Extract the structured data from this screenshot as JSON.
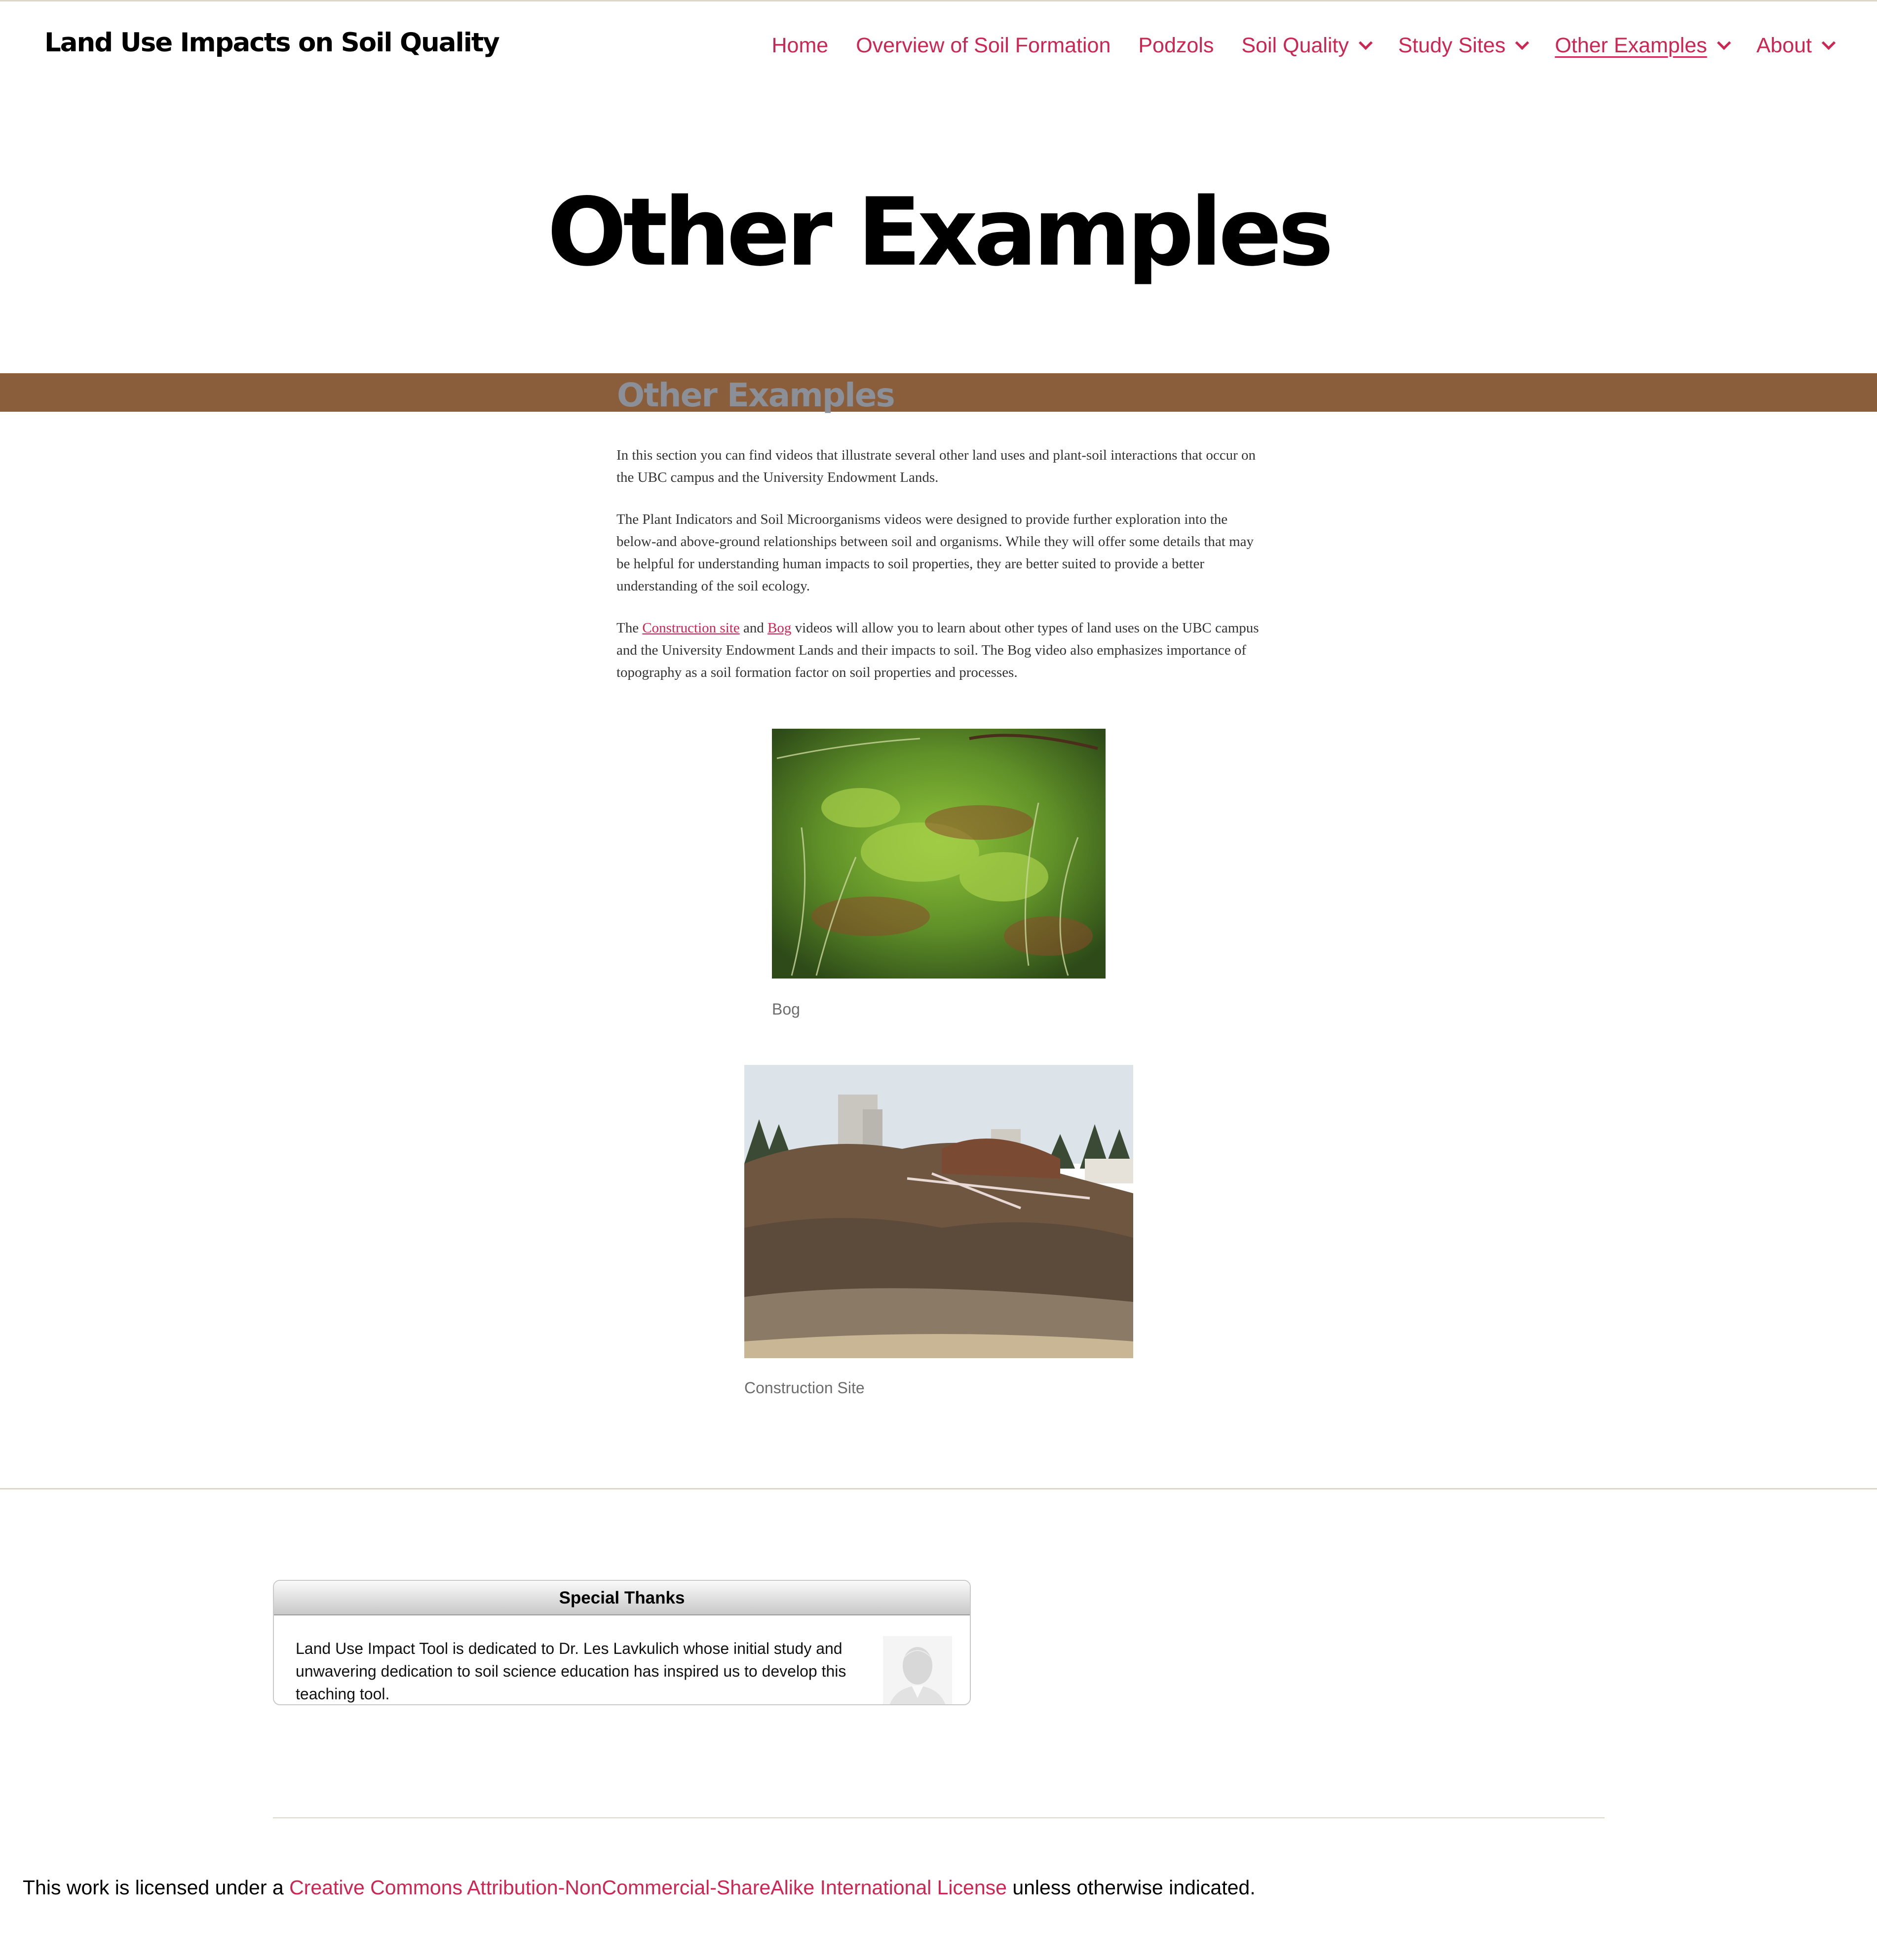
{
  "site": {
    "title": "Land Use Impacts on Soil Quality"
  },
  "nav": {
    "items": [
      {
        "label": "Home",
        "has_dropdown": false,
        "current": false
      },
      {
        "label": "Overview of Soil Formation",
        "has_dropdown": false,
        "current": false
      },
      {
        "label": "Podzols",
        "has_dropdown": false,
        "current": false
      },
      {
        "label": "Soil Quality",
        "has_dropdown": true,
        "current": false
      },
      {
        "label": "Study Sites",
        "has_dropdown": true,
        "current": false
      },
      {
        "label": "Other Examples",
        "has_dropdown": true,
        "current": true
      },
      {
        "label": "About",
        "has_dropdown": true,
        "current": false
      }
    ]
  },
  "page": {
    "title": "Other Examples",
    "banner_title": "Other Examples"
  },
  "article": {
    "p1": "In this section you can find videos that illustrate several other land uses and plant-soil interactions that occur on the UBC campus and the University Endowment Lands.",
    "p2": "The Plant Indicators and Soil Microorganisms videos were designed to provide further exploration into the below-and above-ground relationships between soil and organisms. While they will offer some details that may be helpful for understanding human impacts to soil properties,  they are better suited to provide a better understanding of the soil ecology.",
    "p3_start": "The ",
    "p3_link1": "Construction site",
    "p3_mid": " and ",
    "p3_link2": "Bog",
    "p3_end": " videos will allow you to learn about other types of land uses on the UBC campus and the University Endowment Lands and their impacts to soil. The Bog video also emphasizes importance of topography as a soil formation factor on soil properties and processes."
  },
  "figures": {
    "bog_caption": "Bog",
    "construction_caption": "Construction Site"
  },
  "thanks": {
    "heading": "Special Thanks",
    "body": "Land Use Impact Tool is dedicated to Dr. Les Lavkulich whose initial study and unwavering dedication to soil science education has inspired us to develop this teaching tool."
  },
  "footer": {
    "license_prefix": "This work is licensed under a ",
    "license_link": "Creative Commons Attribution-NonCommercial-ShareAlike International License",
    "license_suffix": " unless otherwise indicated."
  },
  "colors": {
    "accent": "#cd2653",
    "band": "#8a5e3a",
    "banner_title": "#8a8f98"
  }
}
